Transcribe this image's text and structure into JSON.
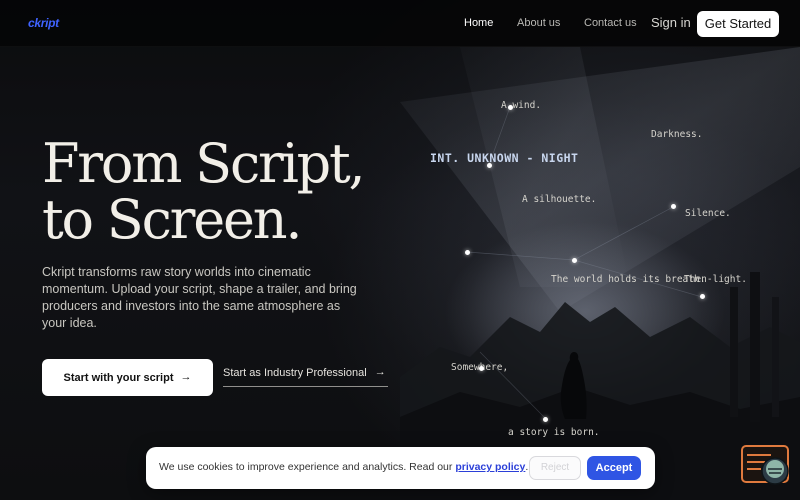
{
  "nav": {
    "logo": "ckript",
    "links": [
      {
        "label": "Home",
        "active": true
      },
      {
        "label": "About us",
        "active": false
      },
      {
        "label": "Contact us",
        "active": false
      }
    ],
    "signin": "Sign in",
    "cta": "Get Started"
  },
  "hero": {
    "title_line1": "From Script,",
    "title_line2": "to Screen.",
    "description": "Ckript transforms raw story worlds into cinematic momentum. Upload your script, shape a trailer, and bring producers and investors into the same atmosphere as your idea.",
    "primary_cta": "Start with your script",
    "secondary_cta": "Start as Industry Professional"
  },
  "scene": {
    "heading": "INT. UNKNOWN - NIGHT",
    "words": {
      "wind": "A wind.",
      "darkness": "Darkness.",
      "silhouette": "A silhouette.",
      "silence": "Silence.",
      "world": "The world holds its breath.",
      "light": "Then-light.",
      "somewhere": "Somewhere,",
      "story": "a story is born."
    }
  },
  "cookie": {
    "text": "We use cookies to improve experience and analytics. Read our",
    "link": "privacy policy",
    "suffix": ".",
    "reject": "Reject",
    "accept": "Accept"
  },
  "colors": {
    "brand": "#3f63ff",
    "accept": "#2f55e4",
    "chat_widget": "#e07a3e"
  },
  "icons": {
    "primary_arrow": "arrow-right-icon",
    "secondary_arrow": "arrow-right-icon",
    "chat": "chat-widget-icon"
  }
}
